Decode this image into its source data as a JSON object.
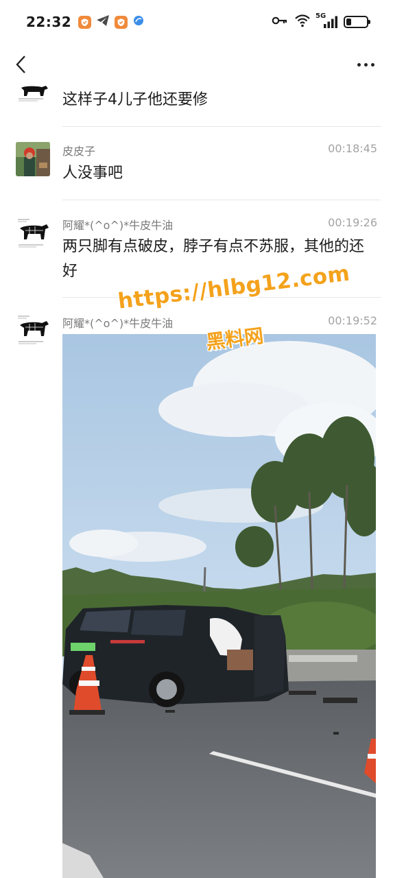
{
  "status_bar": {
    "time": "22:32",
    "network": "5G",
    "icons_left": [
      "shield-app-icon",
      "send-icon",
      "shield-app-icon",
      "bubble-app-icon"
    ],
    "icons_right": [
      "key-icon",
      "wifi-icon",
      "signal-icon",
      "battery-icon"
    ],
    "battery_level": 0.25
  },
  "nav": {
    "back": "back-icon",
    "more": "more-icon"
  },
  "comments": [
    {
      "author": "",
      "time": "",
      "text": "这样子4儿子他还要修"
    },
    {
      "author": "皮皮子",
      "time": "00:18:45",
      "text": "人没事吧"
    },
    {
      "author": "阿耀*(^o^)*牛皮牛油",
      "time": "00:19:26",
      "text": "两只脚有点破皮，脖子有点不苏服，其他的还好"
    },
    {
      "author": "阿耀*(^o^)*牛皮牛油",
      "time": "00:19:52",
      "text": ""
    }
  ],
  "watermark": {
    "url": "https://hlbg12.com",
    "label": "黑料网"
  },
  "colors": {
    "accent_orange": "#f4a21c",
    "name_gray": "#7a7a7a",
    "time_gray": "#a3a3a3",
    "text": "#1c1c1c"
  }
}
